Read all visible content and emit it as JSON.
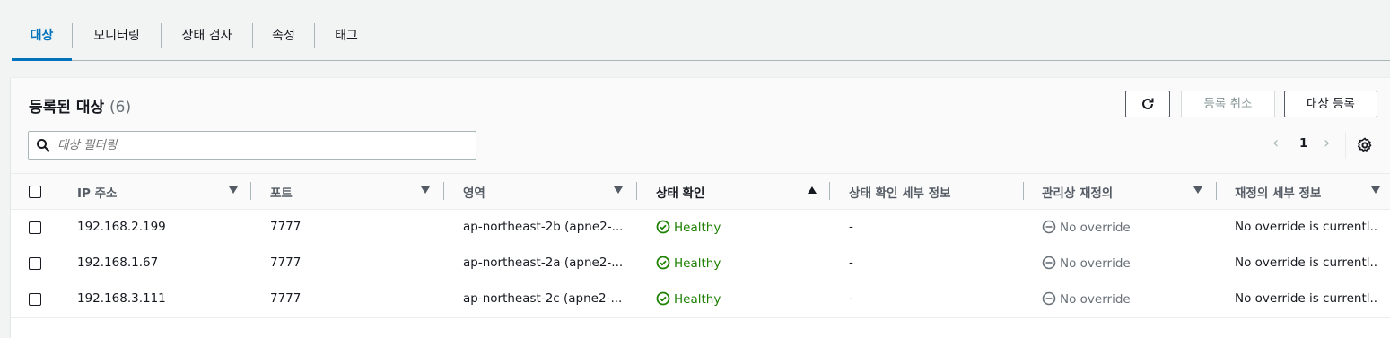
{
  "tabs": [
    {
      "label": "대상"
    },
    {
      "label": "모니터링"
    },
    {
      "label": "상태 검사"
    },
    {
      "label": "속성"
    },
    {
      "label": "태그"
    }
  ],
  "panel": {
    "title": "등록된 대상",
    "count": "(6)",
    "buttons": {
      "refresh": "refresh-icon",
      "deregister": "등록 취소",
      "register": "대상 등록"
    },
    "search": {
      "placeholder": "대상 필터링"
    },
    "pagination": {
      "current": "1"
    }
  },
  "table": {
    "columns": [
      "IP 주소",
      "포트",
      "영역",
      "상태 확인",
      "상태 확인 세부 정보",
      "관리상 재정의",
      "재정의 세부 정보"
    ],
    "sorted_column": "상태 확인",
    "rows": [
      {
        "ip": "192.168.2.199",
        "port": "7777",
        "zone": "ap-northeast-2b (apne2-...",
        "health": "Healthy",
        "health_detail": "-",
        "override": "No override",
        "override_detail": "No override is currentl..."
      },
      {
        "ip": "192.168.1.67",
        "port": "7777",
        "zone": "ap-northeast-2a (apne2-...",
        "health": "Healthy",
        "health_detail": "-",
        "override": "No override",
        "override_detail": "No override is currentl..."
      },
      {
        "ip": "192.168.3.111",
        "port": "7777",
        "zone": "ap-northeast-2c (apne2-...",
        "health": "Healthy",
        "health_detail": "-",
        "override": "No override",
        "override_detail": "No override is currentl..."
      }
    ]
  },
  "colors": {
    "accent": "#0073bb",
    "healthy": "#1d8102",
    "border": "#aab7b8"
  }
}
